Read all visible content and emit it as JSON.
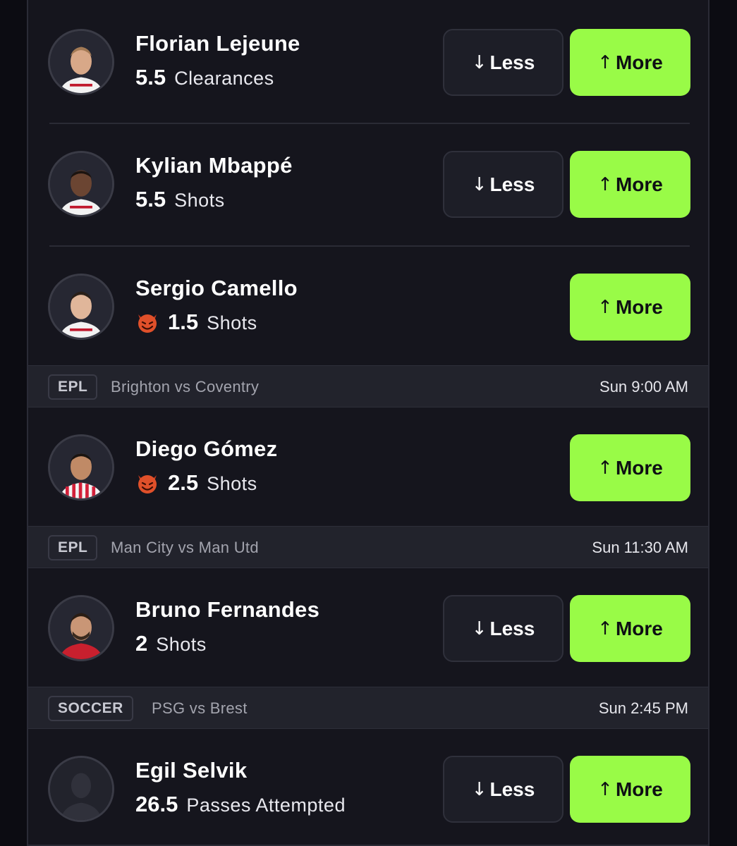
{
  "players": [
    {
      "name": "Florian Lejeune",
      "line": "5.5",
      "metric": "Clearances",
      "demon": false,
      "less_label": "Less",
      "more_label": "More",
      "less_arrow": "↓",
      "more_arrow": "↑"
    },
    {
      "name": "Kylian Mbappé",
      "line": "5.5",
      "metric": "Shots",
      "demon": false,
      "less_label": "Less",
      "more_label": "More",
      "less_arrow": "↓",
      "more_arrow": "↑"
    },
    {
      "name": "Sergio Camello",
      "line": "1.5",
      "metric": "Shots",
      "demon": true,
      "more_label": "More",
      "more_arrow": "↑"
    },
    {
      "name": "Diego Gómez",
      "line": "2.5",
      "metric": "Shots",
      "demon": true,
      "more_label": "More",
      "more_arrow": "↑"
    },
    {
      "name": "Bruno Fernandes",
      "line": "2",
      "metric": "Shots",
      "demon": false,
      "less_label": "Less",
      "more_label": "More",
      "less_arrow": "↓",
      "more_arrow": "↑"
    },
    {
      "name": "Egil Selvik",
      "line": "26.5",
      "metric": "Passes Attempted",
      "demon": false,
      "less_label": "Less",
      "more_label": "More",
      "less_arrow": "↓",
      "more_arrow": "↑"
    }
  ],
  "games": [
    {
      "league": "EPL",
      "matchup": "Brighton vs Coventry",
      "time": "Sun 9:00 AM"
    },
    {
      "league": "EPL",
      "matchup": "Man City vs Man Utd",
      "time": "Sun 11:30 AM"
    },
    {
      "league": "SOCCER",
      "matchup": "PSG vs Brest",
      "time": "Sun 2:45 PM"
    }
  ],
  "colors": {
    "more_button": "#99fb47",
    "panel": "#15151d",
    "header": "#22232c",
    "background": "#0c0c12"
  },
  "icons": {
    "demon": "demon-emoji-icon",
    "arrow_down": "arrow-down-icon",
    "arrow_up": "arrow-up-icon"
  }
}
